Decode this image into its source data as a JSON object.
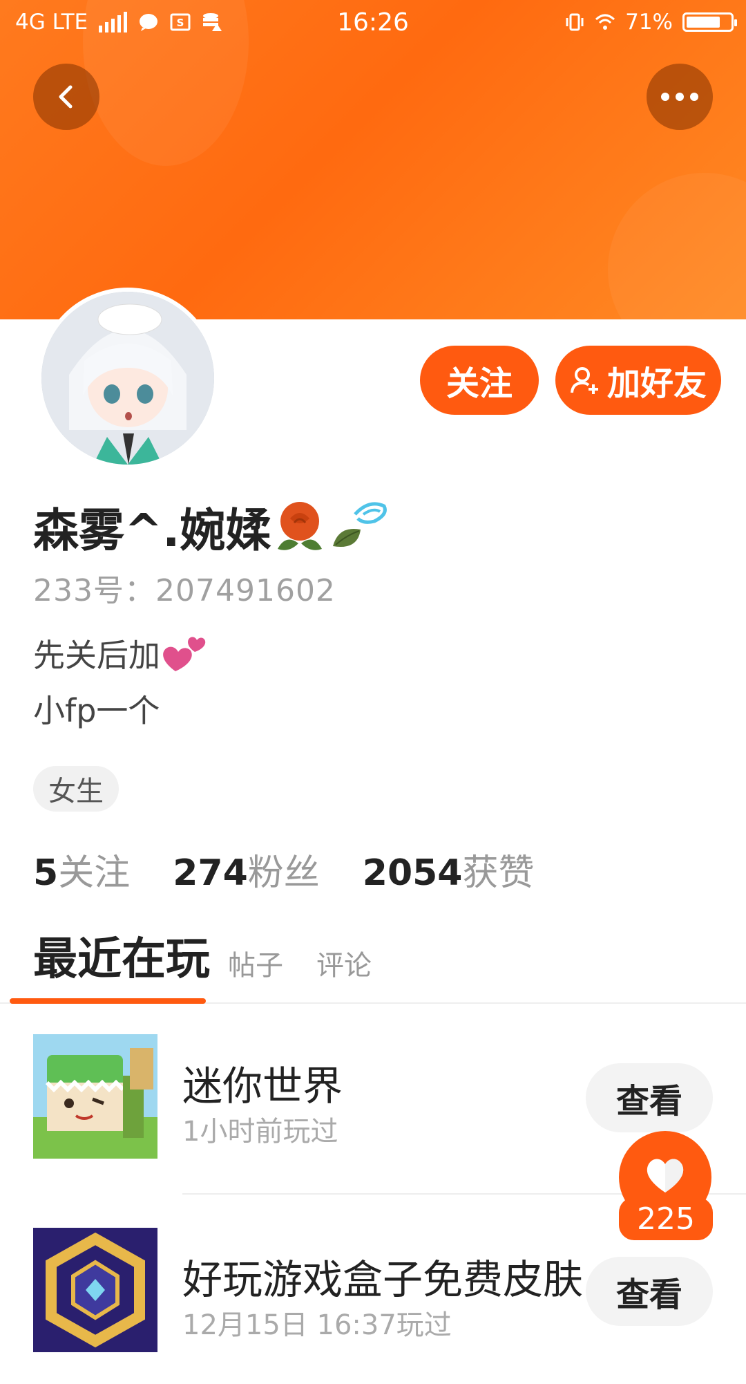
{
  "status_bar": {
    "network": "4G LTE",
    "time": "16:26",
    "battery": "71%"
  },
  "header": {
    "accent_color": "#ff6a10",
    "back_icon": "chevron-left-icon",
    "more_icon": "more-dots-icon"
  },
  "profile": {
    "follow_label": "关注",
    "add_friend_label": "加好友",
    "name": "森雾^.婉媃",
    "uid": "233号：207491602",
    "bio_line1": "先关后加",
    "bio_line2": "小fp一个",
    "gender_tag": "女生",
    "stats": [
      {
        "count": "5",
        "label": "关注"
      },
      {
        "count": "274",
        "label": "粉丝"
      },
      {
        "count": "2054",
        "label": "获赞"
      }
    ]
  },
  "tabs": [
    {
      "label": "最近在玩"
    },
    {
      "label": "帖子"
    },
    {
      "label": "评论"
    }
  ],
  "games": [
    {
      "title": "迷你世界",
      "subtitle": "1小时前玩过",
      "action": "查看"
    },
    {
      "title": "好玩游戏盒子免费皮肤",
      "subtitle": "12月15日 16:37玩过",
      "action": "查看"
    }
  ],
  "like_fab": {
    "count": "225",
    "icon": "heart-icon"
  }
}
